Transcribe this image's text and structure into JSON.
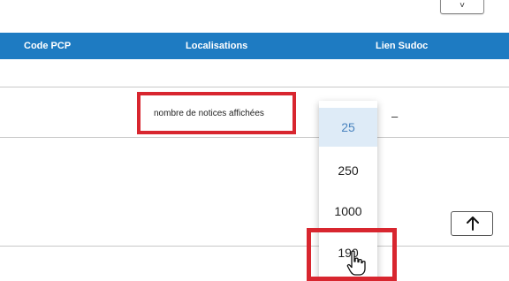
{
  "top_button": {
    "icon": "chevron-down-icon",
    "glyph": "˅"
  },
  "table": {
    "headers": [
      "Code PCP",
      "Localisations",
      "Lien Sudoc"
    ],
    "header_color": "#1e7bc2"
  },
  "row": {
    "label": "nombre de notices affichées",
    "lien_value": "–"
  },
  "page_size_select": {
    "options": [
      "25",
      "250",
      "1000",
      "190"
    ],
    "selected": "25"
  },
  "highlight_color": "#d8262f",
  "scroll_top_button": {
    "icon": "arrow-up-icon"
  },
  "cursor": {
    "icon": "hand-pointer-icon"
  }
}
